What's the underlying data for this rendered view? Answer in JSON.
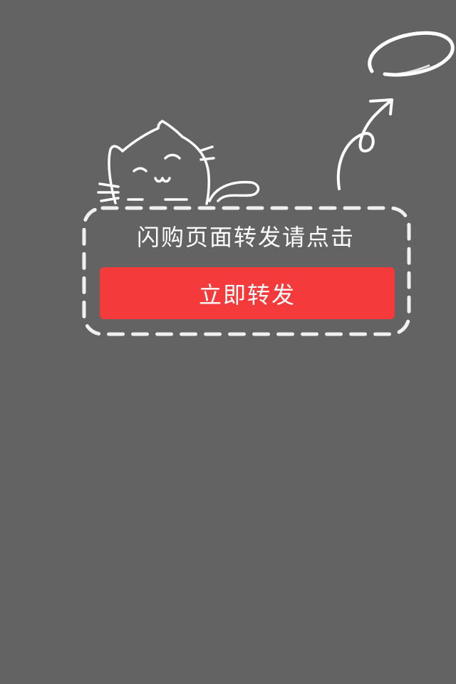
{
  "overlay": {
    "hint": "闪购页面转发请点击",
    "share_button_label": "立即转发"
  },
  "colors": {
    "background": "#636363",
    "accent": "#f43a3b",
    "stroke": "#ffffff"
  },
  "icons": [
    "cat-doodle-icon",
    "arrow-doodle-icon",
    "circle-doodle-icon",
    "dashed-frame"
  ]
}
